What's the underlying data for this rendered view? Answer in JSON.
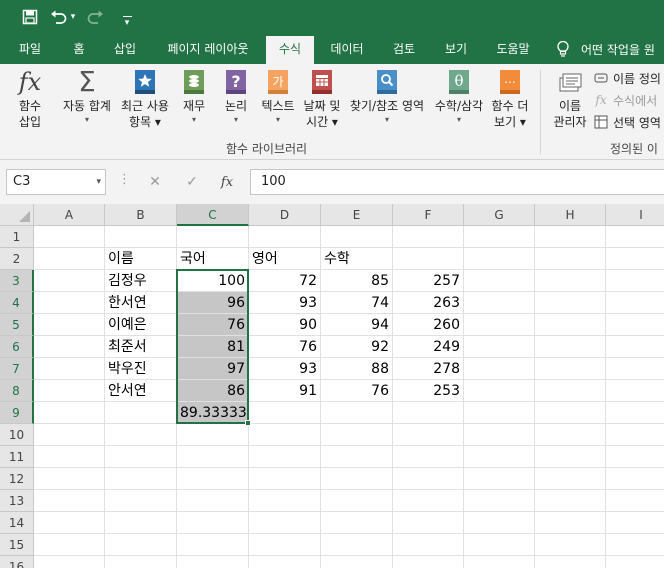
{
  "qat": {
    "undo_arrow": "▾",
    "customize": "▾"
  },
  "tabs": [
    {
      "label": "파일",
      "active": false
    },
    {
      "label": "홈",
      "active": false
    },
    {
      "label": "삽입",
      "active": false
    },
    {
      "label": "페이지 레이아웃",
      "active": false
    },
    {
      "label": "수식",
      "active": true
    },
    {
      "label": "데이터",
      "active": false
    },
    {
      "label": "검토",
      "active": false
    },
    {
      "label": "보기",
      "active": false
    },
    {
      "label": "도움말",
      "active": false
    }
  ],
  "tell_me": "어떤 작업을 원",
  "ribbon": {
    "insert_function": {
      "line1": "함수",
      "line2": "삽입"
    },
    "autosum": {
      "line1": "자동 합계",
      "caret": "▾"
    },
    "recent": {
      "line1": "최근 사용",
      "line2": "항목 ▾"
    },
    "financial": {
      "line1": "재무",
      "caret": "▾"
    },
    "logical": {
      "line1": "논리",
      "caret": "▾"
    },
    "text": {
      "line1": "텍스트",
      "caret": "▾"
    },
    "datetime": {
      "line1": "날짜 및",
      "line2": "시간 ▾"
    },
    "lookup": {
      "line1": "찾기/참조 영역",
      "caret": "▾"
    },
    "math": {
      "line1": "수학/삼각",
      "caret": "▾"
    },
    "more": {
      "line1": "함수 더",
      "line2": "보기 ▾"
    },
    "library_group": "함수 라이브러리",
    "name_manager": {
      "line1": "이름",
      "line2": "관리자"
    },
    "define_name": "이름 정의",
    "use_in_formula": "수식에서",
    "create_from_selection": "선택 영역",
    "names_group": "정의된 이"
  },
  "formula_bar": {
    "name_box": "C3",
    "name_box_caret": "▾",
    "dots": "⋮",
    "cancel": "✕",
    "enter": "✓",
    "fx": "fx",
    "value": "100"
  },
  "columns": [
    "A",
    "B",
    "C",
    "D",
    "E",
    "F",
    "G",
    "H",
    "I"
  ],
  "rows": [
    "1",
    "2",
    "3",
    "4",
    "5",
    "6",
    "7",
    "8",
    "9",
    "10",
    "11",
    "12",
    "13",
    "14",
    "15",
    "16"
  ],
  "cells": {
    "B2": "이름",
    "C2": "국어",
    "D2": "영어",
    "E2": "수학",
    "B3": "김정우",
    "C3": "100",
    "D3": "72",
    "E3": "85",
    "F3": "257",
    "B4": "한서연",
    "C4": "96",
    "D4": "93",
    "E4": "74",
    "F4": "263",
    "B5": "이예은",
    "C5": "76",
    "D5": "90",
    "E5": "94",
    "F5": "260",
    "B6": "최준서",
    "C6": "81",
    "D6": "76",
    "E6": "92",
    "F6": "249",
    "B7": "박우진",
    "C7": "97",
    "D7": "93",
    "E7": "88",
    "F7": "278",
    "B8": "안서연",
    "C8": "86",
    "D8": "91",
    "E8": "76",
    "F8": "253",
    "C9": "89.33333"
  },
  "colors": {
    "accent": "#217346",
    "selection_fill": "#c6c6c6"
  }
}
